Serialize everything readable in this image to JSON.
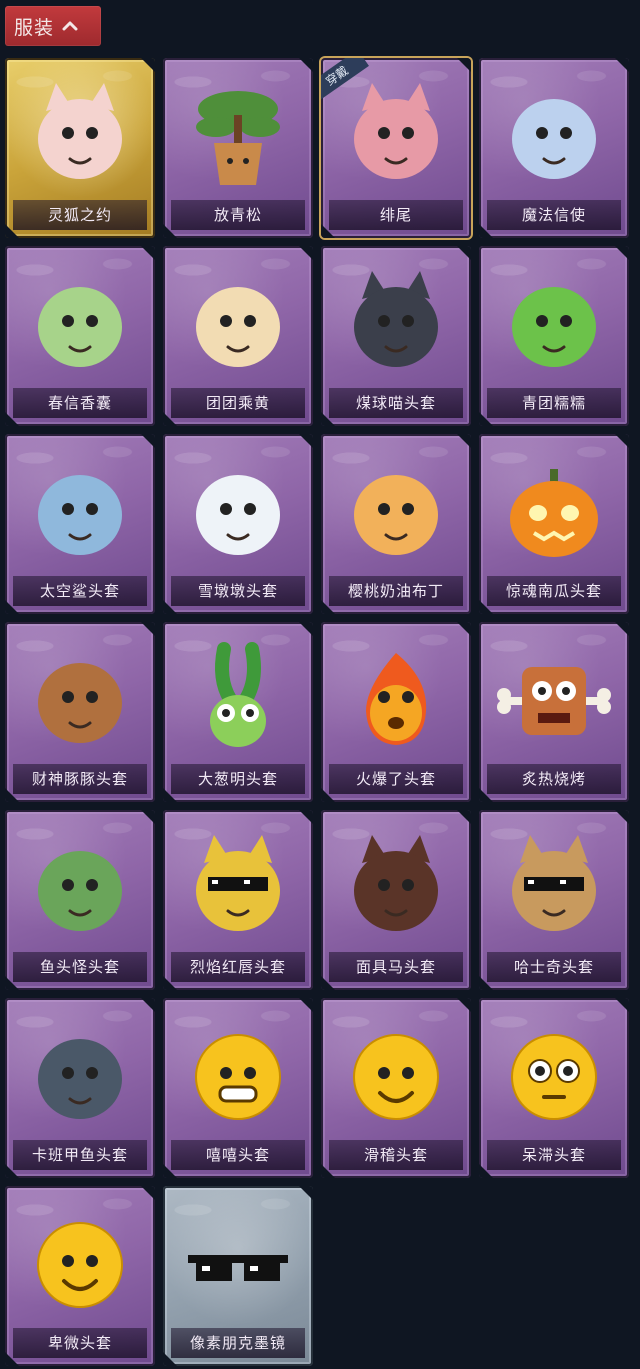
{
  "header": {
    "label": "服装"
  },
  "ribbon": "穿戴",
  "items": [
    {
      "name": "灵狐之约",
      "style": "gold",
      "icon": "fox-spirit-icon",
      "color": "#f4d3cf"
    },
    {
      "name": "放青松",
      "style": "purple",
      "icon": "bonsai-pine-icon",
      "color": "#4f8f3a"
    },
    {
      "name": "绯尾",
      "style": "purple",
      "icon": "fox-tail-girl-icon",
      "color": "#e79aa6",
      "selected": true
    },
    {
      "name": "魔法信使",
      "style": "purple",
      "icon": "elephant-icon",
      "color": "#bcd1ee"
    },
    {
      "name": "春信香囊",
      "style": "purple",
      "icon": "sachet-icon",
      "color": "#a7d38a"
    },
    {
      "name": "团团乘黄",
      "style": "purple",
      "icon": "round-beast-icon",
      "color": "#f2dcb3"
    },
    {
      "name": "煤球喵头套",
      "style": "purple",
      "icon": "black-cat-icon",
      "color": "#3b3f4b"
    },
    {
      "name": "青团糯糯",
      "style": "purple",
      "icon": "green-dumpling-icon",
      "color": "#6cc24a"
    },
    {
      "name": "太空鲨头套",
      "style": "purple",
      "icon": "shark-icon",
      "color": "#8fb8dc"
    },
    {
      "name": "雪墩墩头套",
      "style": "purple",
      "icon": "snowman-icon",
      "color": "#eef3f8"
    },
    {
      "name": "樱桃奶油布丁",
      "style": "purple",
      "icon": "pudding-icon",
      "color": "#f2b15a"
    },
    {
      "name": "惊魂南瓜头套",
      "style": "purple",
      "icon": "pumpkin-icon",
      "color": "#f08a1e"
    },
    {
      "name": "财神豚豚头套",
      "style": "purple",
      "icon": "capybara-icon",
      "color": "#b0703e"
    },
    {
      "name": "大葱明头套",
      "style": "purple",
      "icon": "scallion-icon",
      "color": "#8ccf5a"
    },
    {
      "name": "火爆了头套",
      "style": "purple",
      "icon": "fireball-icon",
      "color": "#f5a623"
    },
    {
      "name": "炙热烧烤",
      "style": "purple",
      "icon": "meat-bone-icon",
      "color": "#c8703a"
    },
    {
      "name": "鱼头怪头套",
      "style": "purple",
      "icon": "fish-head-icon",
      "color": "#6aa55a"
    },
    {
      "name": "烈焰红唇头套",
      "style": "purple",
      "icon": "yellow-mask-icon",
      "color": "#e8c23a"
    },
    {
      "name": "面具马头套",
      "style": "purple",
      "icon": "horse-mask-icon",
      "color": "#5a3428"
    },
    {
      "name": "哈士奇头套",
      "style": "purple",
      "icon": "husky-icon",
      "color": "#c89a5e"
    },
    {
      "name": "卡班甲鱼头套",
      "style": "purple",
      "icon": "fish-icon",
      "color": "#4a5868"
    },
    {
      "name": "嘻嘻头套",
      "style": "purple",
      "icon": "grin-emoji-icon",
      "color": "#f7c31e"
    },
    {
      "name": "滑稽头套",
      "style": "purple",
      "icon": "smirk-emoji-icon",
      "color": "#f7c31e"
    },
    {
      "name": "呆滞头套",
      "style": "purple",
      "icon": "stare-emoji-icon",
      "color": "#f7c31e"
    },
    {
      "name": "卑微头套",
      "style": "purple",
      "icon": "shy-emoji-icon",
      "color": "#f7c31e"
    },
    {
      "name": "像素朋克墨镜",
      "style": "grey",
      "icon": "pixel-sunglasses-icon",
      "color": "#111111"
    }
  ]
}
